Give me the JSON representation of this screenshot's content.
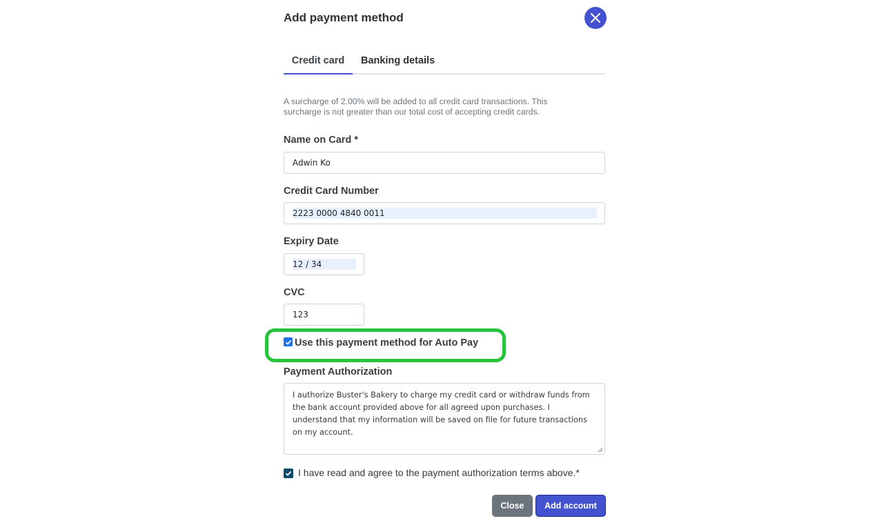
{
  "dialog": {
    "title": "Add payment method",
    "close_icon": "close-icon",
    "accent_color": "#4352cf"
  },
  "tabs": [
    {
      "label": "Credit card",
      "active": true
    },
    {
      "label": "Banking details",
      "active": false
    }
  ],
  "notice": "A surcharge of 2.00% will be added to all credit card transactions. This surcharge is not greater than our total cost of accepting credit cards.",
  "form": {
    "name_label": "Name on Card *",
    "name_value": "Adwin Ko",
    "card_label": "Credit Card Number",
    "card_value": "2223 0000 4840 0011",
    "expiry_label": "Expiry Date",
    "expiry_value": "12 / 34",
    "cvc_label": "CVC",
    "cvc_value": "123",
    "autopay_label": "Use this payment method for Auto Pay",
    "autopay_checked": true,
    "authorization_label": "Payment Authorization",
    "authorization_text": "I authorize Buster's Bakery to charge my credit card or withdraw funds from the bank account provided above for all agreed upon purchases. I understand that my information will be saved on file for future transactions on my account.",
    "agree_label": "I have read and agree to the payment authorization terms above.*",
    "agree_checked": true
  },
  "buttons": {
    "close": "Close",
    "add": "Add account"
  },
  "highlight_color": "#27c33b"
}
